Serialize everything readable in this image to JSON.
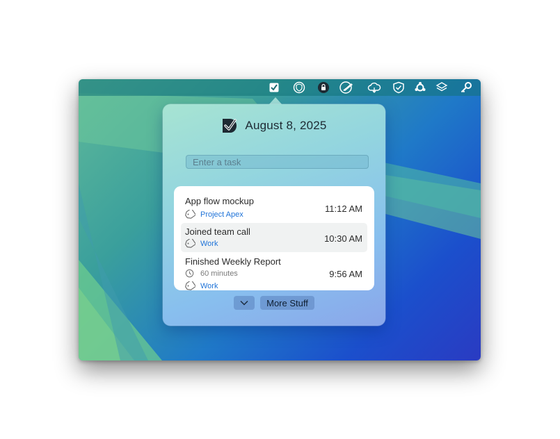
{
  "menubar": {
    "icons": [
      "task-checkbox-icon",
      "vpn-shield-icon",
      "lock-icon",
      "feather-pen-icon",
      "cloud-sync-icon",
      "shield-check-icon",
      "network-hub-icon",
      "layers-icon",
      "key-icon"
    ]
  },
  "popover": {
    "date": "August 8, 2025",
    "task_input": {
      "placeholder": "Enter a task",
      "value": ""
    },
    "tasks": [
      {
        "title": "App flow mockup",
        "tag": "Project Apex",
        "time": "11:12 AM",
        "selected": false
      },
      {
        "title": "Joined team call",
        "tag": "Work",
        "time": "10:30 AM",
        "selected": true
      },
      {
        "title": "Finished Weekly Report",
        "duration": "60 minutes",
        "tag": "Work",
        "time": "9:56 AM",
        "selected": false
      }
    ],
    "more_button": "More Stuff"
  },
  "colors": {
    "accent_tag": "#1f73d8",
    "menubar": "#127378"
  }
}
